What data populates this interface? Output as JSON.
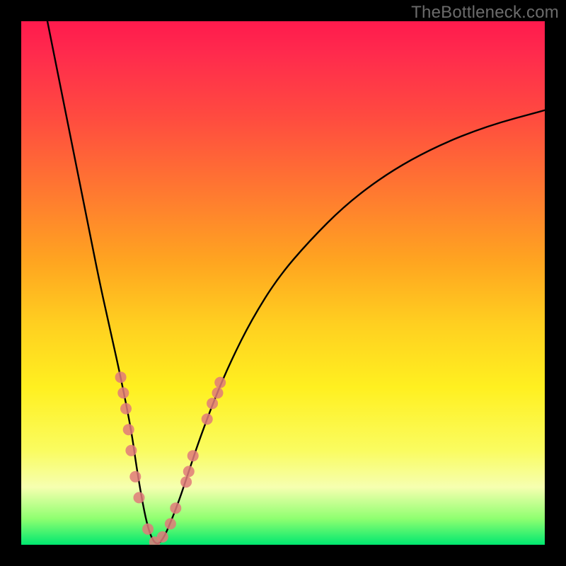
{
  "watermark": "TheBottleneck.com",
  "chart_data": {
    "type": "line",
    "title": "",
    "xlabel": "",
    "ylabel": "",
    "xlim": [
      0,
      100
    ],
    "ylim": [
      0,
      100
    ],
    "grid": false,
    "background_gradient": {
      "direction": "vertical",
      "stops": [
        {
          "pos": 0.0,
          "color": "#ff1a4d"
        },
        {
          "pos": 0.06,
          "color": "#ff2a4d"
        },
        {
          "pos": 0.18,
          "color": "#ff4a40"
        },
        {
          "pos": 0.33,
          "color": "#ff7a30"
        },
        {
          "pos": 0.46,
          "color": "#ffa520"
        },
        {
          "pos": 0.58,
          "color": "#ffd020"
        },
        {
          "pos": 0.7,
          "color": "#fff020"
        },
        {
          "pos": 0.82,
          "color": "#fafc60"
        },
        {
          "pos": 0.89,
          "color": "#f6ffb0"
        },
        {
          "pos": 0.95,
          "color": "#8fff70"
        },
        {
          "pos": 1.0,
          "color": "#00e870"
        }
      ]
    },
    "series": [
      {
        "name": "bottleneck-curve",
        "style": {
          "color": "#000000",
          "width": 2.4
        },
        "x": [
          5,
          7,
          9,
          11,
          13,
          15,
          17,
          19,
          21,
          22,
          23,
          24,
          25,
          26,
          27,
          28,
          30,
          32,
          34,
          37,
          40,
          44,
          49,
          55,
          62,
          70,
          79,
          89,
          100
        ],
        "y": [
          100,
          90,
          80,
          70,
          60,
          50,
          41,
          32,
          22,
          15,
          9,
          4,
          1,
          0,
          1,
          3,
          8,
          14,
          20,
          28,
          35,
          43,
          51,
          58,
          65,
          71,
          76,
          80,
          83
        ]
      }
    ],
    "markers": {
      "name": "highlight-points",
      "style": {
        "color": "#e07a7a",
        "radius": 8,
        "opacity": 0.85
      },
      "points": [
        {
          "x": 19.0,
          "y": 32
        },
        {
          "x": 19.5,
          "y": 29
        },
        {
          "x": 20.0,
          "y": 26
        },
        {
          "x": 20.5,
          "y": 22
        },
        {
          "x": 21.0,
          "y": 18
        },
        {
          "x": 21.8,
          "y": 13
        },
        {
          "x": 22.5,
          "y": 9
        },
        {
          "x": 24.2,
          "y": 3
        },
        {
          "x": 25.5,
          "y": 0.5
        },
        {
          "x": 27.0,
          "y": 1.5
        },
        {
          "x": 28.5,
          "y": 4
        },
        {
          "x": 29.5,
          "y": 7
        },
        {
          "x": 31.5,
          "y": 12
        },
        {
          "x": 32.0,
          "y": 14
        },
        {
          "x": 32.8,
          "y": 17
        },
        {
          "x": 35.5,
          "y": 24
        },
        {
          "x": 36.5,
          "y": 27
        },
        {
          "x": 37.5,
          "y": 29
        },
        {
          "x": 38.0,
          "y": 31
        }
      ]
    }
  }
}
